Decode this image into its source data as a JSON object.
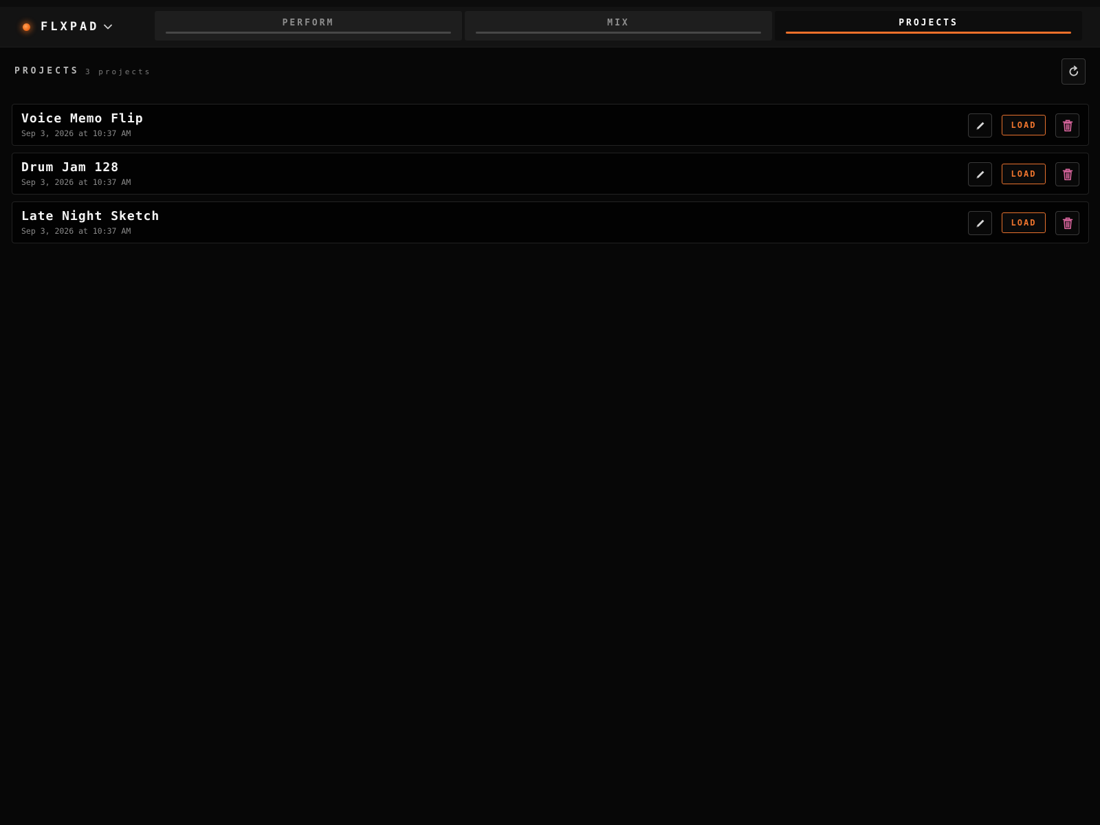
{
  "app": {
    "name": "FLXPAD"
  },
  "tabs": [
    {
      "label": "PERFORM",
      "active": false
    },
    {
      "label": "MIX",
      "active": false
    },
    {
      "label": "PROJECTS",
      "active": true
    }
  ],
  "projects_section": {
    "title": "PROJECTS",
    "count_label": "3 projects"
  },
  "projects": [
    {
      "name": "Voice Memo Flip",
      "date": "Sep 3, 2026 at 10:37 AM",
      "load_label": "LOAD"
    },
    {
      "name": "Drum Jam 128",
      "date": "Sep 3, 2026 at 10:37 AM",
      "load_label": "LOAD"
    },
    {
      "name": "Late Night Sketch",
      "date": "Sep 3, 2026 at 10:37 AM",
      "load_label": "LOAD"
    }
  ],
  "icons": {
    "brand": "status-dot-icon",
    "brand_menu": "chevron-down-icon",
    "refresh": "refresh-icon",
    "edit": "pencil-icon",
    "delete": "trash-icon"
  },
  "colors": {
    "accent": "#f2702a",
    "delete": "#e46aa5",
    "background": "#070707"
  }
}
